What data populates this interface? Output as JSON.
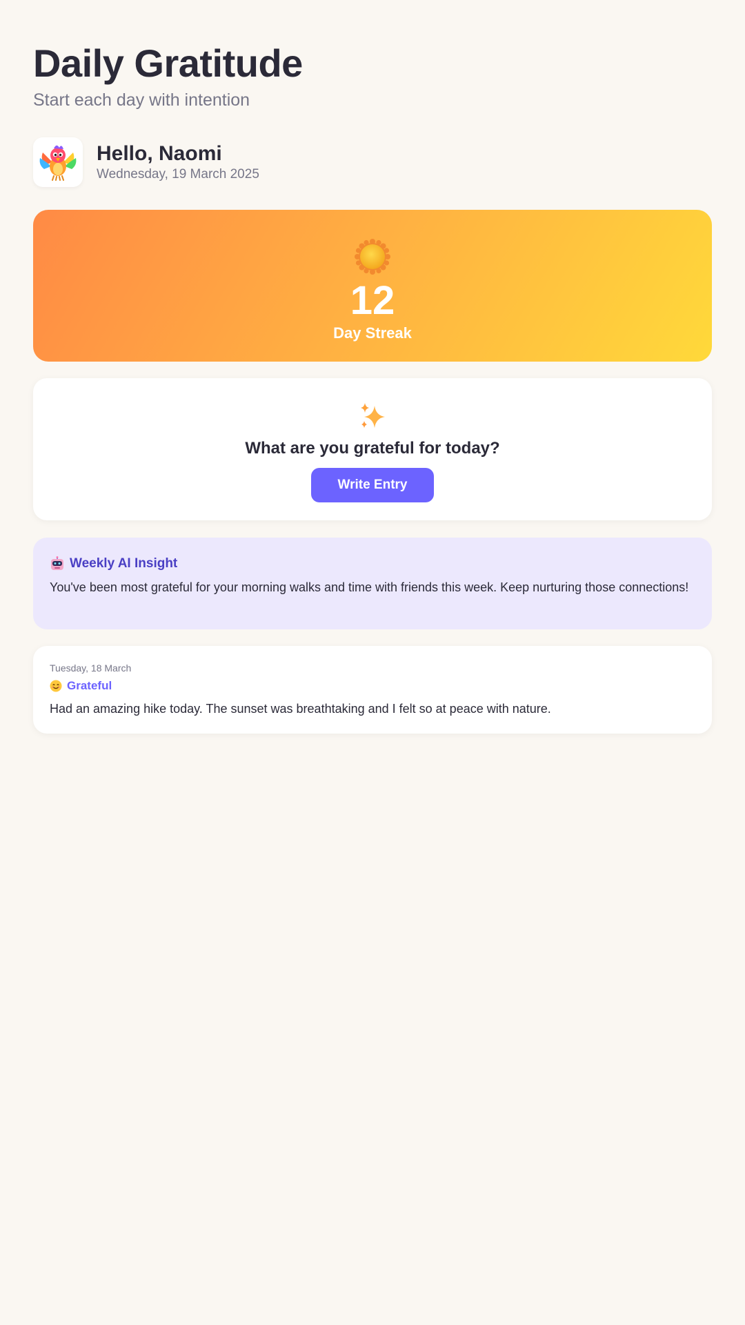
{
  "app": {
    "title": "Daily Gratitude",
    "subtitle": "Start each day with intention"
  },
  "user": {
    "greeting": "Hello, Naomi",
    "date": "Wednesday, 19 March 2025",
    "avatar_icon": "parrot-icon"
  },
  "streak": {
    "icon": "sun-icon",
    "count": "12",
    "label": "Day Streak",
    "gradient_colors": [
      "#ff8a45",
      "#ffb042",
      "#ffd93a"
    ]
  },
  "prompt": {
    "icon": "sparkles-icon",
    "question": "What are you grateful for today?",
    "button_label": "Write Entry"
  },
  "insight": {
    "icon": "robot-icon",
    "title": "Weekly AI Insight",
    "body": "You've been most grateful for your morning walks and time with friends this week. Keep nurturing those connections!"
  },
  "entries": [
    {
      "date": "Tuesday, 18 March",
      "mood_icon": "smile-icon",
      "mood": "Grateful",
      "text": "Had an amazing hike today. The sunset was breathtaking and I felt so at peace with nature."
    }
  ],
  "colors": {
    "background": "#faf7f2",
    "accent": "#6c63ff",
    "insight_background": "#ece8fd",
    "insight_title": "#4a3fc4",
    "text_primary": "#2b2a38",
    "text_muted": "#767688"
  }
}
